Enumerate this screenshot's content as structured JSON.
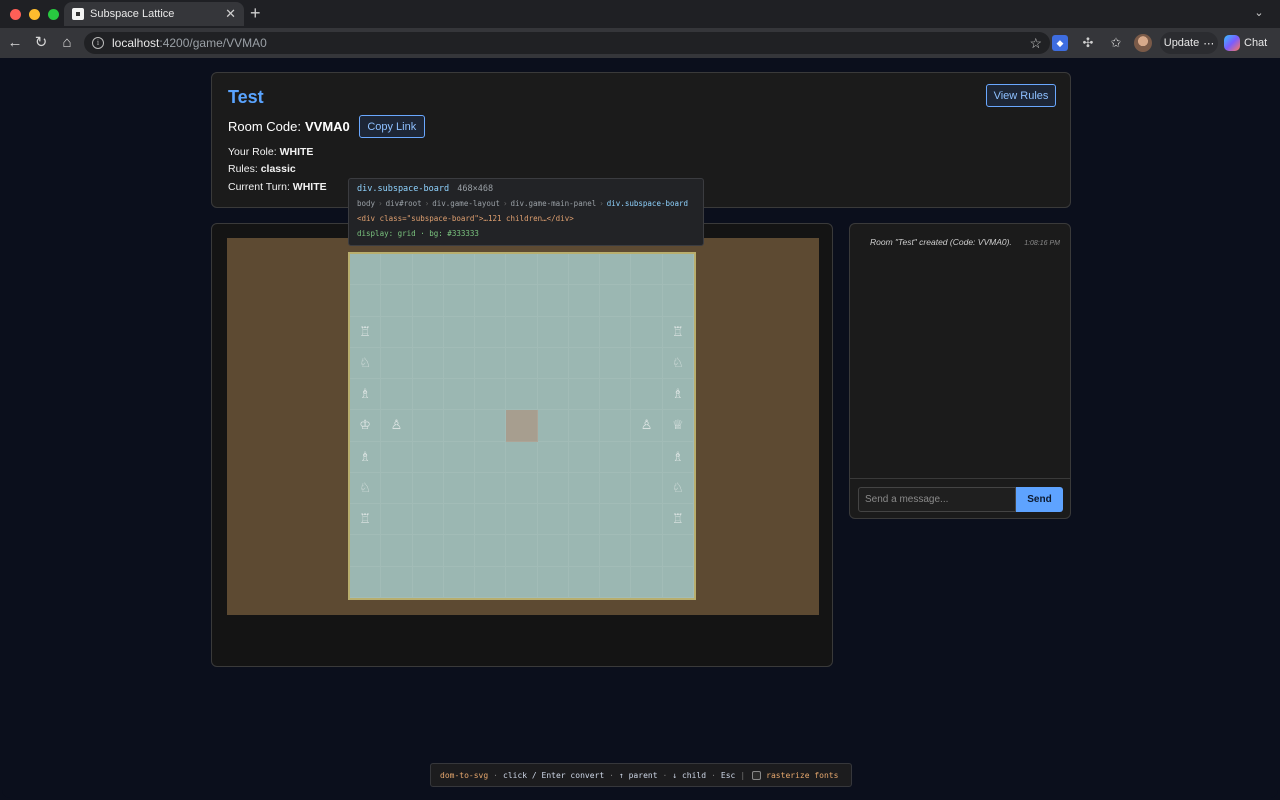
{
  "browser": {
    "tab_title": "Subspace Lattice",
    "tab_close": "✕",
    "new_tab": "+",
    "url_host": "localhost",
    "url_path": ":4200/game/VVMA0",
    "update_label": "Update",
    "update_more": "⋯",
    "chat_label": "Chat"
  },
  "game": {
    "title": "Test",
    "view_rules_label": "View Rules",
    "room_code_label": "Room Code:",
    "room_code": "VVMA0",
    "copy_link_label": "Copy Link",
    "role_label": "Your Role:",
    "role_value": "WHITE",
    "rules_label": "Rules:",
    "rules_value": "classic",
    "turn_label": "Current Turn:",
    "turn_value": "WHITE"
  },
  "board": {
    "size": 11,
    "pieces": [
      {
        "row": 2,
        "col": 0,
        "glyph": "♖",
        "name": "white-rook"
      },
      {
        "row": 2,
        "col": 10,
        "glyph": "♖",
        "name": "white-rook"
      },
      {
        "row": 3,
        "col": 0,
        "glyph": "♘",
        "name": "white-knight"
      },
      {
        "row": 3,
        "col": 10,
        "glyph": "♘",
        "name": "white-knight"
      },
      {
        "row": 4,
        "col": 0,
        "glyph": "♗",
        "name": "white-bishop"
      },
      {
        "row": 4,
        "col": 10,
        "glyph": "♗",
        "name": "white-bishop"
      },
      {
        "row": 5,
        "col": 0,
        "glyph": "♔",
        "name": "white-king"
      },
      {
        "row": 5,
        "col": 1,
        "glyph": "♙",
        "name": "white-pawn"
      },
      {
        "row": 5,
        "col": 9,
        "glyph": "♙",
        "name": "white-pawn"
      },
      {
        "row": 5,
        "col": 10,
        "glyph": "♕",
        "name": "white-queen"
      },
      {
        "row": 6,
        "col": 0,
        "glyph": "♗",
        "name": "white-bishop"
      },
      {
        "row": 6,
        "col": 10,
        "glyph": "♗",
        "name": "white-bishop"
      },
      {
        "row": 7,
        "col": 0,
        "glyph": "♘",
        "name": "white-knight"
      },
      {
        "row": 7,
        "col": 10,
        "glyph": "♘",
        "name": "white-knight"
      },
      {
        "row": 8,
        "col": 0,
        "glyph": "♖",
        "name": "white-rook"
      },
      {
        "row": 8,
        "col": 10,
        "glyph": "♖",
        "name": "white-rook"
      }
    ],
    "highlight": {
      "row": 5,
      "col": 5
    }
  },
  "chat": {
    "messages": [
      {
        "text": "Room \"Test\" created (Code: VVMA0).",
        "time": "1:08:16 PM"
      }
    ],
    "input_placeholder": "Send a message...",
    "send_label": "Send"
  },
  "inspector": {
    "selector": "div.subspace-board",
    "size": "468×468",
    "crumbs": [
      "body",
      "div#root",
      "div.game-layout",
      "div.game-main-panel",
      "div.subspace-board"
    ],
    "html": "<div class=\"subspace-board\">…121 children…</div>",
    "css": "display: grid · bg: #333333"
  },
  "status_bar": {
    "tool": "dom-to-svg",
    "click": "click / Enter convert",
    "parent": "↑ parent",
    "child": "↓ child",
    "esc": "Esc",
    "rasterize": "rasterize fonts"
  },
  "colors": {
    "accent": "#5aa4ff",
    "board_bg": "#9bb7b2",
    "board_surround": "#5d4a32",
    "page_bg": "#0b0f1c"
  }
}
